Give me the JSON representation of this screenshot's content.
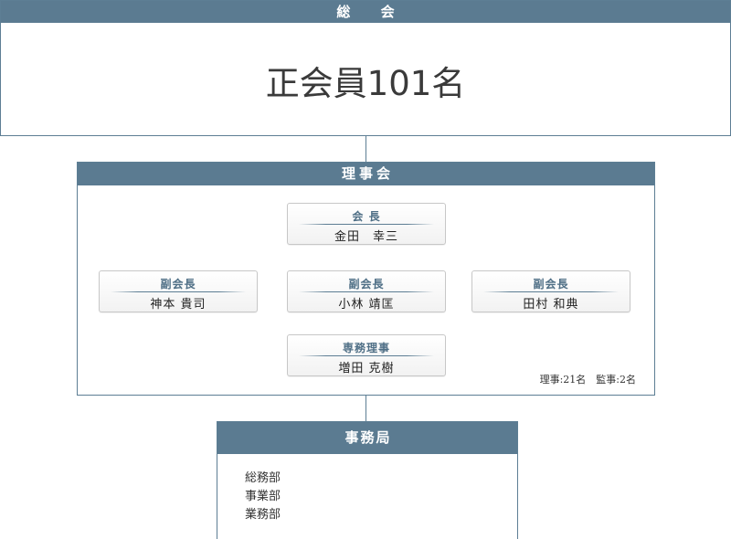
{
  "general_assembly": {
    "title": "総 会",
    "members": "正会員101名"
  },
  "board": {
    "title": "理事会",
    "roles": [
      {
        "title": "会 長",
        "name": "金田　幸三"
      },
      {
        "title": "副会長",
        "name": "神本 貴司"
      },
      {
        "title": "副会長",
        "name": "小林 靖匡"
      },
      {
        "title": "副会長",
        "name": "田村 和典"
      },
      {
        "title": "専務理事",
        "name": "増田 克樹"
      }
    ],
    "counts": "理事:21名　監事:2名"
  },
  "secretariat": {
    "title": "事務局",
    "departments": [
      "総務部",
      "事業部",
      "業務部"
    ]
  },
  "colors": {
    "header": "#5b7b91",
    "border": "#5d7e94",
    "role_title": "#4f6f86"
  }
}
